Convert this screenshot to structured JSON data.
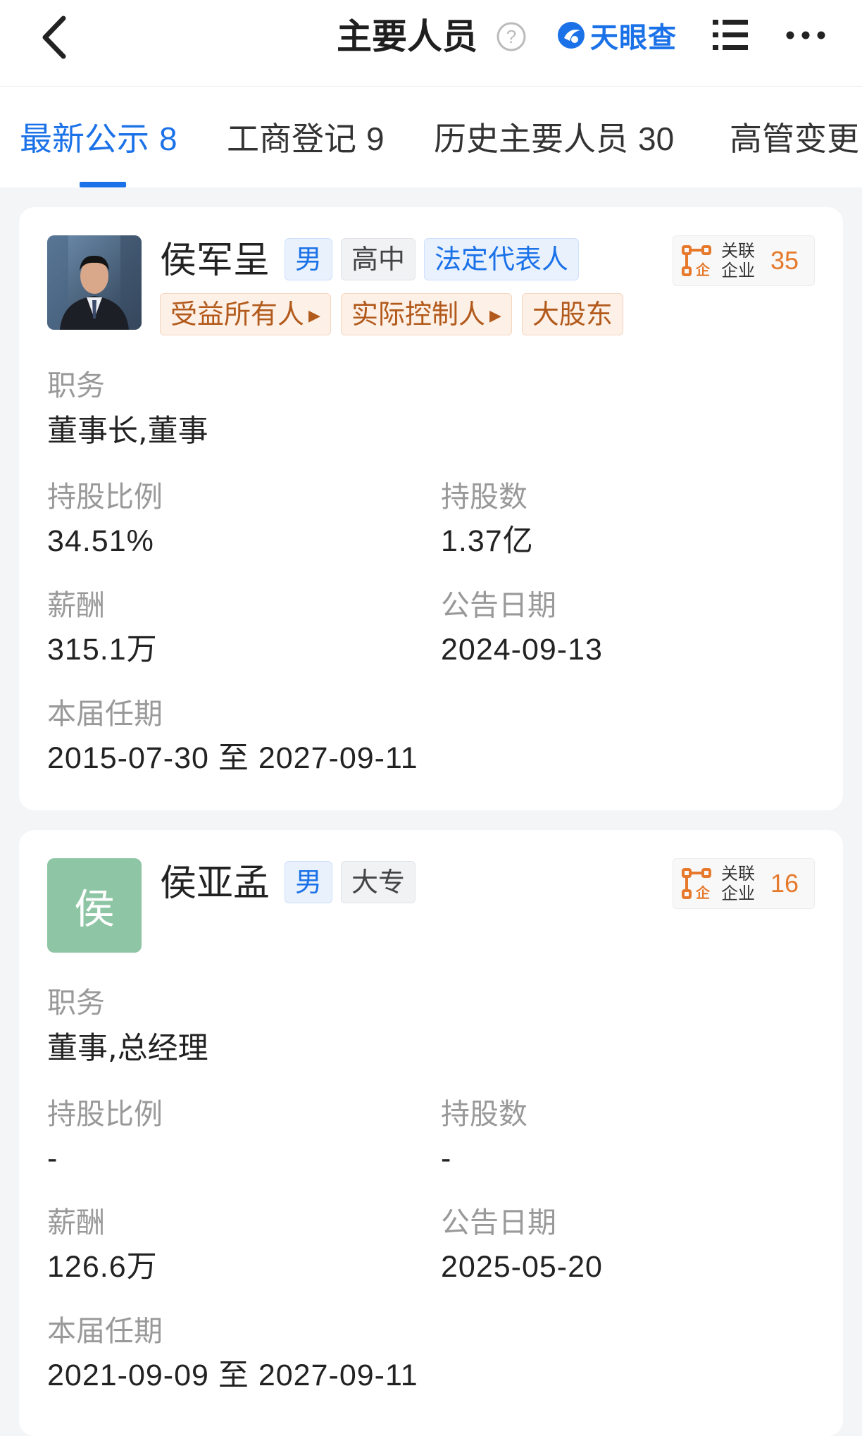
{
  "header": {
    "title": "主要人员",
    "brand": "天眼查"
  },
  "tabs": [
    {
      "label": "最新公示",
      "count": "8"
    },
    {
      "label": "工商登记",
      "count": "9"
    },
    {
      "label": "历史主要人员",
      "count": "30"
    },
    {
      "label": "高管变更",
      "count": ""
    }
  ],
  "people": [
    {
      "name": "侯军呈",
      "tags": [
        "男",
        "高中",
        "法定代表人"
      ],
      "roles": [
        "受益所有人",
        "实际控制人",
        "大股东"
      ],
      "related_label": "关联企业",
      "related_count": "35",
      "position_label": "职务",
      "position": "董事长,董事",
      "share_ratio_label": "持股比例",
      "share_ratio": "34.51%",
      "shares_label": "持股数",
      "shares": "1.37亿",
      "salary_label": "薪酬",
      "salary": "315.1万",
      "date_label": "公告日期",
      "date": "2024-09-13",
      "term_label": "本届任期",
      "term": "2015-07-30 至 2027-09-11"
    },
    {
      "name": "侯亚孟",
      "avatar_letter": "侯",
      "tags": [
        "男",
        "大专"
      ],
      "related_label": "关联企业",
      "related_count": "16",
      "position_label": "职务",
      "position": "董事,总经理",
      "share_ratio_label": "持股比例",
      "share_ratio": "-",
      "shares_label": "持股数",
      "shares": "-",
      "salary_label": "薪酬",
      "salary": "126.6万",
      "date_label": "公告日期",
      "date": "2025-05-20",
      "term_label": "本届任期",
      "term": "2021-09-09 至 2027-09-11"
    }
  ]
}
